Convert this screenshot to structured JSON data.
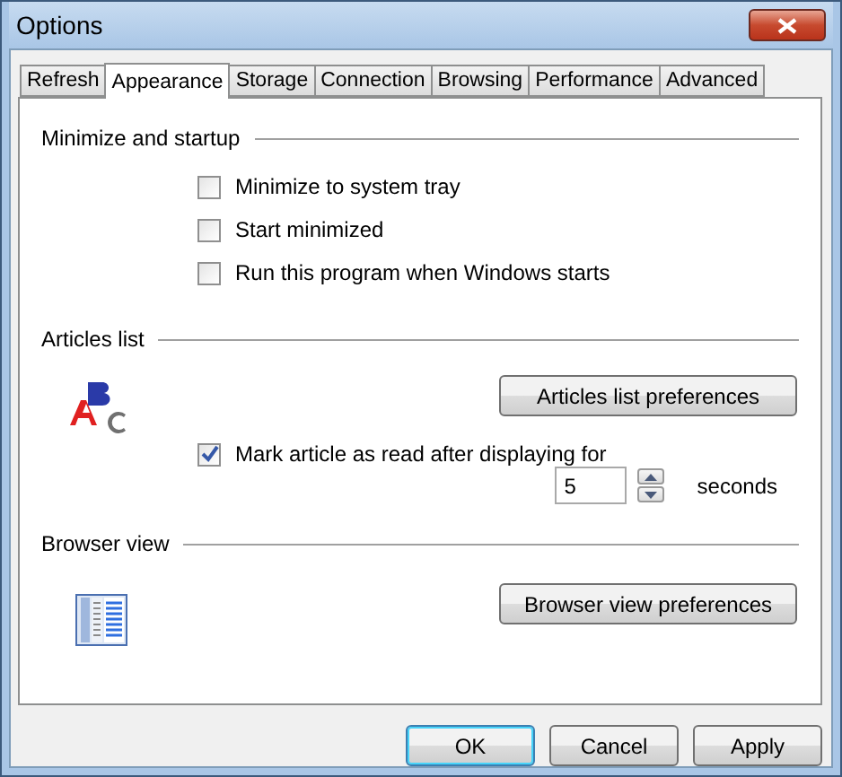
{
  "window": {
    "title": "Options"
  },
  "tabs": [
    {
      "label": "Refresh",
      "selected": false
    },
    {
      "label": "Appearance",
      "selected": true
    },
    {
      "label": "Storage",
      "selected": false
    },
    {
      "label": "Connection",
      "selected": false
    },
    {
      "label": "Browsing",
      "selected": false
    },
    {
      "label": "Performance",
      "selected": false
    },
    {
      "label": "Advanced",
      "selected": false
    }
  ],
  "minimize_and_startup": {
    "title": "Minimize and startup",
    "options": [
      {
        "label": "Minimize to system tray",
        "checked": false
      },
      {
        "label": "Start minimized",
        "checked": false
      },
      {
        "label": "Run this program when Windows starts",
        "checked": false
      }
    ]
  },
  "articles_list": {
    "title": "Articles list",
    "button": "Articles list preferences",
    "option": {
      "label": "Mark article as read after displaying for",
      "checked": true
    },
    "delay": {
      "value": "5",
      "unit": "seconds"
    }
  },
  "browser_view": {
    "title": "Browser view",
    "button": "Browser view preferences"
  },
  "buttons": [
    {
      "label": "OK",
      "focused": true
    },
    {
      "label": "Cancel",
      "focused": false
    },
    {
      "label": "Apply",
      "focused": false
    }
  ]
}
